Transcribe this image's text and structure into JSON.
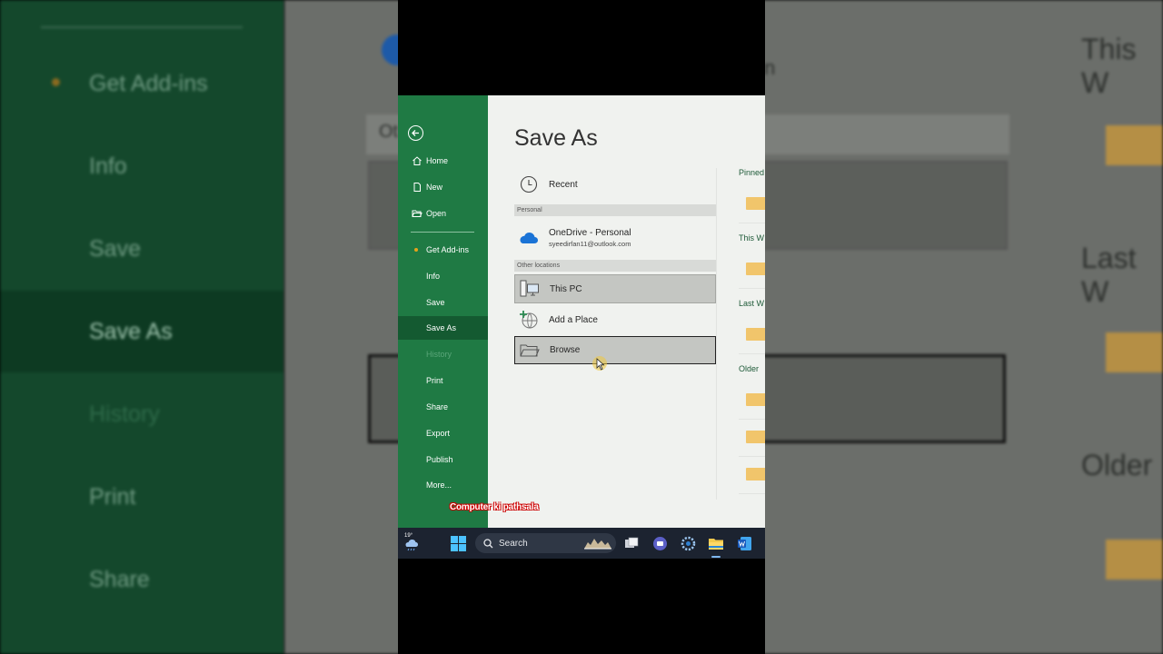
{
  "backdrop": {
    "left_items": [
      {
        "name": "bg-get-addins",
        "label": "Get Add-ins",
        "dot": true
      },
      {
        "name": "bg-info",
        "label": "Info"
      },
      {
        "name": "bg-save",
        "label": "Save"
      },
      {
        "name": "bg-save-as",
        "label": "Save As"
      },
      {
        "name": "bg-history",
        "label": "History"
      },
      {
        "name": "bg-print",
        "label": "Print"
      },
      {
        "name": "bg-share",
        "label": "Share"
      }
    ],
    "right_labels": {
      "this_week": "This W",
      "last_week": "Last W",
      "older": "Older",
      "other_fragment": "Ot",
      "fragment_n": "n"
    }
  },
  "backstage": {
    "title": "Save As",
    "nav": {
      "home": "Home",
      "new": "New",
      "open": "Open",
      "get_addins": "Get Add-ins",
      "info": "Info",
      "save": "Save",
      "save_as": "Save As",
      "history": "History",
      "print": "Print",
      "share": "Share",
      "export": "Export",
      "publish": "Publish",
      "more": "More..."
    },
    "locations": {
      "recent": "Recent",
      "personal_header": "Personal",
      "onedrive_title": "OneDrive - Personal",
      "onedrive_email": "syeedirfan11@outlook.com",
      "other_header": "Other locations",
      "this_pc": "This PC",
      "add_place": "Add a Place",
      "browse": "Browse"
    },
    "pinned": {
      "pinned": "Pinned",
      "this_week": "This W",
      "last_week": "Last W",
      "older": "Older"
    }
  },
  "watermark": "Computer ki pathsala",
  "taskbar": {
    "weather_temp": "19°",
    "search": "Search"
  },
  "colors": {
    "nav_green": "#1f7a44",
    "nav_selected": "#145a31",
    "folder": "#f1c56b",
    "taskbar": "#1c2330"
  }
}
